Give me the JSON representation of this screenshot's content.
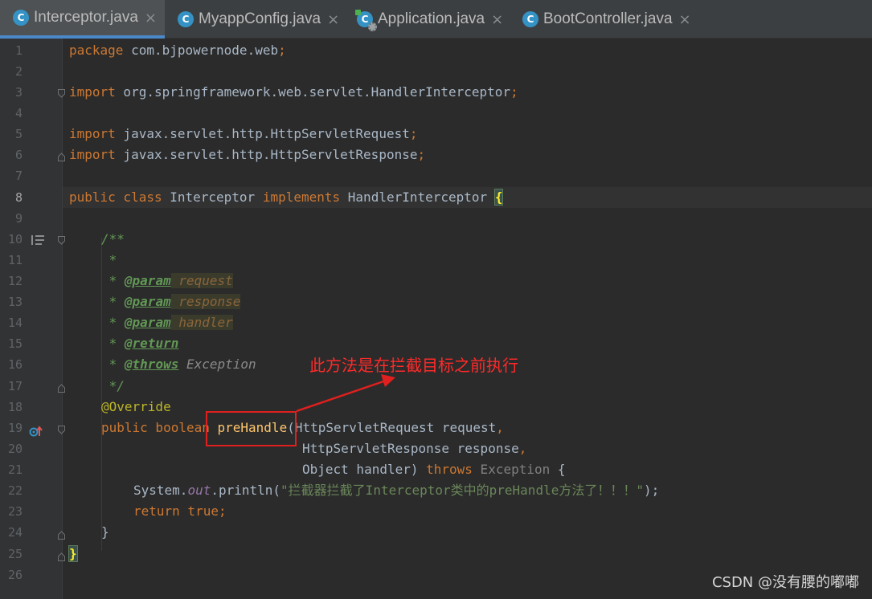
{
  "tabs": [
    {
      "label": "Interceptor.java",
      "icon": "java-class-icon",
      "active": true
    },
    {
      "label": "MyappConfig.java",
      "icon": "java-class-icon",
      "active": false
    },
    {
      "label": "Application.java",
      "icon": "spring-boot-application-icon",
      "active": false
    },
    {
      "label": "BootController.java",
      "icon": "java-class-icon",
      "active": false
    }
  ],
  "tab_icon_letter": "C",
  "close_glyph": "×",
  "line_numbers": [
    "1",
    "2",
    "3",
    "4",
    "5",
    "6",
    "7",
    "8",
    "9",
    "10",
    "11",
    "12",
    "13",
    "14",
    "15",
    "16",
    "17",
    "18",
    "19",
    "20",
    "21",
    "22",
    "23",
    "24",
    "25",
    "26"
  ],
  "current_line": "8",
  "code": {
    "l1_kw": "package",
    "l1_rest": " com.bjpowernode.web",
    "l1_semi": ";",
    "l3_kw": "import",
    "l3_rest": " org.springframework.web.servlet.HandlerInterceptor",
    "l3_semi": ";",
    "l5_kw": "import",
    "l5_rest": " javax.servlet.http.HttpServletRequest",
    "l5_semi": ";",
    "l6_kw": "import",
    "l6_rest": " javax.servlet.http.HttpServletResponse",
    "l6_semi": ";",
    "l8_kw1": "public class",
    "l8_name": " Interceptor ",
    "l8_kw2": "implements",
    "l8_iface": " HandlerInterceptor ",
    "l8_brace": "{",
    "l10": "/**",
    "l11": " *",
    "l12_star": " * ",
    "l12_tag": "@param",
    "l12_arg": " request",
    "l13_star": " * ",
    "l13_tag": "@param",
    "l13_arg": " response",
    "l14_star": " * ",
    "l14_tag": "@param",
    "l14_arg": " handler",
    "l15_star": " * ",
    "l15_tag": "@return",
    "l16_star": " * ",
    "l16_tag": "@throws",
    "l16_ref": " Exception",
    "l17": " */",
    "l18": "@Override",
    "l19_kw": "public boolean",
    "l19_sp": " ",
    "l19_fn": "preHandle",
    "l19_rest": "(HttpServletRequest request",
    "l19_comma": ",",
    "l20_rest": "HttpServletResponse response",
    "l20_comma": ",",
    "l21_rest": "Object handler) ",
    "l21_kw": "throws",
    "l21_exc": " Exception",
    "l21_brace": " {",
    "l22_cls": "System.",
    "l22_out": "out",
    "l22_call": ".println(",
    "l22_str": "\"拦截器拦截了Interceptor类中的preHandle方法了！！！\"",
    "l22_end": ");",
    "l23_kw1": "return",
    "l23_kw2": " true",
    "l23_semi": ";",
    "l24": "}",
    "l25": "}"
  },
  "annotation_note": "此方法是在拦截目标之前执行",
  "watermark": "CSDN @没有腰的嘟嘟",
  "colors": {
    "keyword": "#cc7832",
    "comment": "#629755",
    "string": "#6a8759",
    "annotation": "#bbb529",
    "method": "#ffc66d",
    "red_markup": "#e0201e"
  }
}
